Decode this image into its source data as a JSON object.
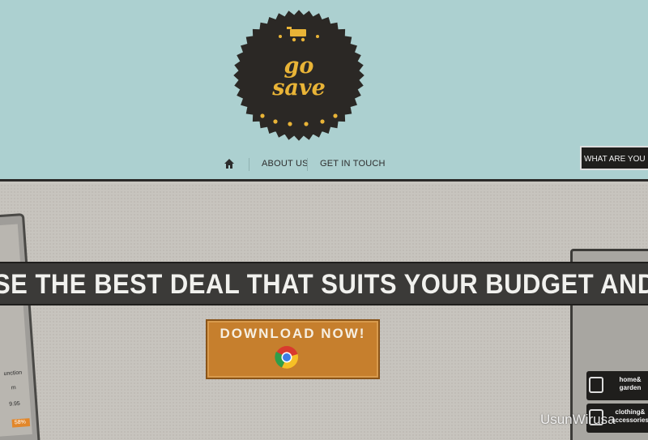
{
  "brand": {
    "logo_text_line1": "go",
    "logo_text_line2": "save",
    "badge_color": "#2b2825",
    "accent_color": "#e9b437"
  },
  "nav": {
    "items": [
      {
        "icon": "home-icon"
      },
      {
        "label": "ABOUT US"
      },
      {
        "label": "GET IN TOUCH"
      }
    ]
  },
  "hero": {
    "banner_text": "SE THE BEST DEAL THAT SUITS YOUR BUDGET AND NEEDS",
    "download_label": "DOWNLOAD NOW!",
    "download_icon": "chrome-icon",
    "button_color": "#c67f2d"
  },
  "left_mockup": {
    "line1": "unction",
    "line2": "9.95",
    "line3": "m",
    "tag": "58%"
  },
  "right_mockup": {
    "question": "WHAT ARE YOU",
    "categories": [
      {
        "label": "home& garden"
      },
      {
        "label": "clothing& accessories"
      }
    ]
  },
  "watermark": "UsunWirusa"
}
